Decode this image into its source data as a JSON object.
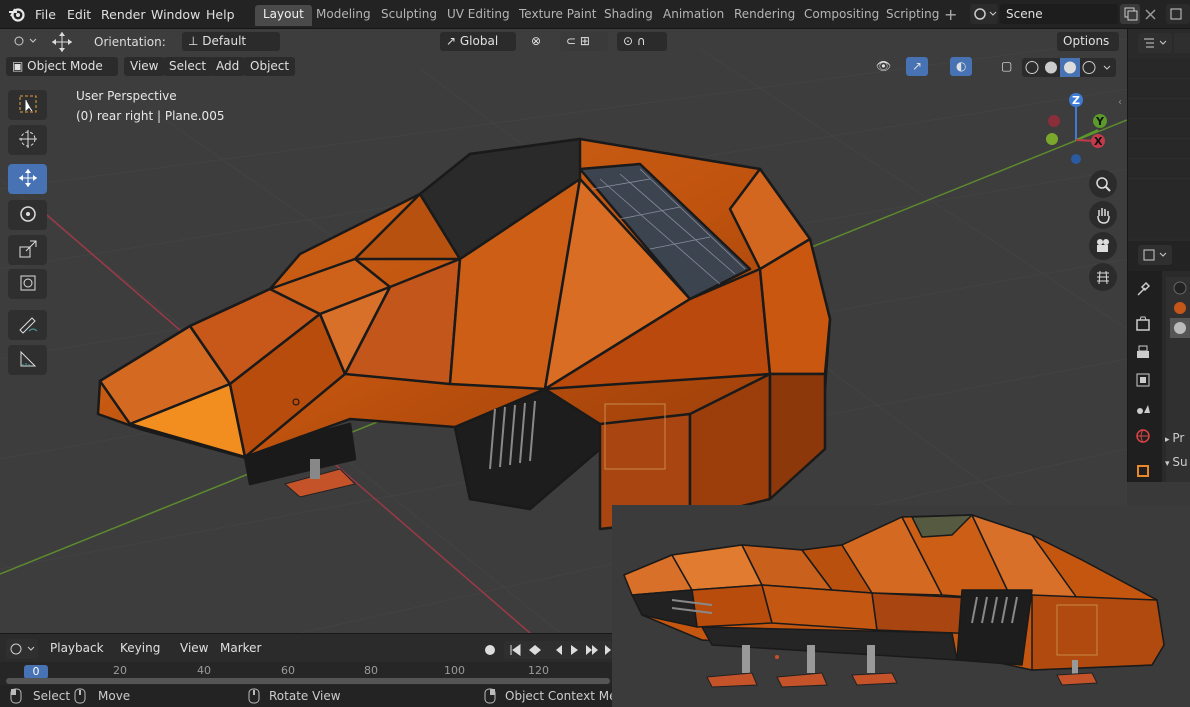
{
  "topbar": {
    "menus": [
      "File",
      "Edit",
      "Render",
      "Window",
      "Help"
    ],
    "workspaces": [
      "Layout",
      "Modeling",
      "Sculpting",
      "UV Editing",
      "Texture Paint",
      "Shading",
      "Animation",
      "Rendering",
      "Compositing",
      "Scripting"
    ],
    "add_workspace": "+",
    "scene_name": "Scene"
  },
  "viewport_header": {
    "orientation_label": "Orientation:",
    "orientation_value": "Default",
    "transform_orientation": "Global",
    "options": "Options",
    "mode": "Object Mode",
    "menus": [
      "View",
      "Select",
      "Add",
      "Object"
    ]
  },
  "overlay": {
    "line1": "User Perspective",
    "line2": "(0) rear right | Plane.005"
  },
  "gizmo": {
    "z": "Z",
    "y": "Y",
    "x": "X"
  },
  "side_panel": {
    "item1": "Pr",
    "item2": "Su"
  },
  "timeline": {
    "menus": [
      "Playback",
      "Keying",
      "View",
      "Marker"
    ],
    "current_frame": "0",
    "ticks": [
      "20",
      "40",
      "60",
      "80",
      "100",
      "120"
    ]
  },
  "statusbar": {
    "select": "Select",
    "move": "Move",
    "rotate": "Rotate View",
    "context": "Object Context Menu"
  },
  "colors": {
    "accent": "#4772b3",
    "ship": "#c4560f",
    "grid_x": "#9b3a46",
    "grid_y": "#5d8a2e"
  }
}
